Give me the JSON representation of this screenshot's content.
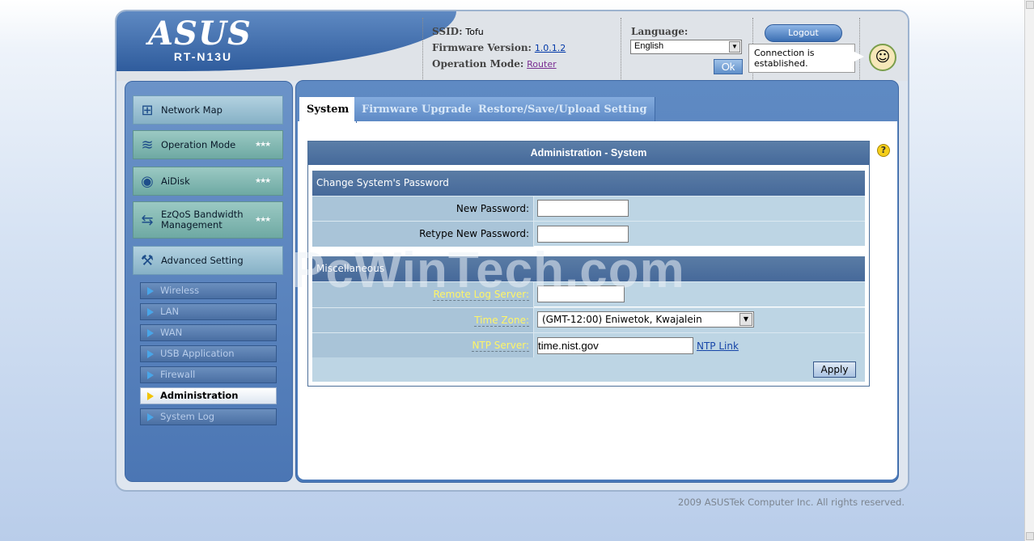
{
  "header": {
    "logo_text": "ASUS",
    "model": "RT-N13U",
    "ssid_label": "SSID:",
    "ssid_value": "Tofu",
    "firmware_label": "Firmware Version:",
    "firmware_value": "1.0.1.2",
    "opmode_label": "Operation Mode:",
    "opmode_value": "Router",
    "language_label": "Language:",
    "language_selected": "English",
    "ok_label": "Ok",
    "logout_label": "Logout",
    "connection_status": "Connection is established."
  },
  "sidebar": {
    "items": [
      {
        "label": "Network Map",
        "icon": "network-map-icon"
      },
      {
        "label": "Operation Mode",
        "icon": "router-icon"
      },
      {
        "label": "AiDisk",
        "icon": "disk-icon"
      },
      {
        "label": "EzQoS Bandwidth Management",
        "icon": "qos-icon"
      },
      {
        "label": "Advanced Setting",
        "icon": "tools-icon"
      }
    ],
    "subitems": [
      {
        "label": "Wireless"
      },
      {
        "label": "LAN"
      },
      {
        "label": "WAN"
      },
      {
        "label": "USB Application"
      },
      {
        "label": "Firewall"
      },
      {
        "label": "Administration",
        "active": true
      },
      {
        "label": "System Log"
      }
    ]
  },
  "tabs": [
    {
      "label": "System",
      "active": true
    },
    {
      "label": "Firmware Upgrade"
    },
    {
      "label": "Restore/Save/Upload Setting"
    }
  ],
  "panel": {
    "title": "Administration - System",
    "password_section": "Change System's Password",
    "new_password_label": "New Password:",
    "new_password_value": "",
    "retype_password_label": "Retype New Password:",
    "retype_password_value": "",
    "misc_section": "Miscellaneous",
    "remote_log_label": "Remote Log Server:",
    "remote_log_value": "",
    "timezone_label": "Time Zone:",
    "timezone_value": "(GMT-12:00) Eniwetok, Kwajalein",
    "ntp_label": "NTP Server:",
    "ntp_value": "time.nist.gov",
    "ntp_link": "NTP Link",
    "apply_label": "Apply"
  },
  "watermark": "PcWinTech.com",
  "footer": "2009 ASUSTek Computer Inc. All rights reserved."
}
